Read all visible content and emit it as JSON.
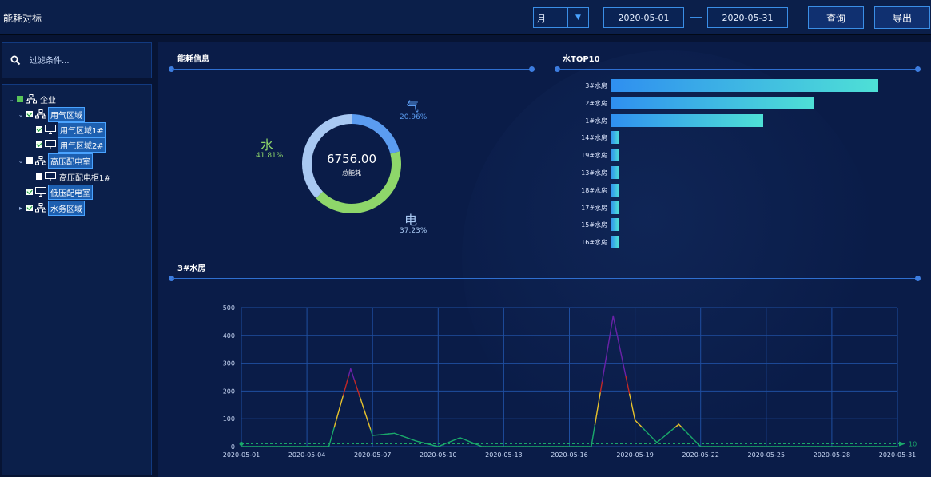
{
  "header": {
    "title": "能耗对标",
    "period": {
      "value": "月"
    },
    "date_start": "2020-05-01",
    "date_end": "2020-05-31",
    "query_label": "查询",
    "export_label": "导出"
  },
  "filter": {
    "placeholder": "过滤条件..."
  },
  "tree": {
    "root": "企业",
    "nodes": [
      "用气区域",
      "用气区域1#",
      "用气区域2#",
      "高压配电室",
      "高压配电柜1#",
      "低压配电室",
      "水务区域"
    ]
  },
  "energy_info": {
    "title": "能耗信息",
    "total_value": "6756.00",
    "total_label": "总能耗",
    "legend": [
      {
        "name": "气",
        "pct": "20.96%",
        "color": "#5b9cf0"
      },
      {
        "name": "水",
        "pct": "41.81%",
        "color": "#8ed66a"
      },
      {
        "name": "电",
        "pct": "37.23%",
        "color": "#a8c8f2"
      }
    ]
  },
  "top10": {
    "title": "水TOP10"
  },
  "trend": {
    "title": "3#水房",
    "end_label": "10"
  },
  "colors": {
    "accent": "#3a8ee6",
    "panel": "#0b1f4a",
    "bg": "#071434"
  },
  "chart_data": [
    {
      "type": "pie",
      "title": "能耗信息",
      "categories": [
        "气",
        "水",
        "电"
      ],
      "values": [
        20.96,
        41.81,
        37.23
      ],
      "total": 6756.0
    },
    {
      "type": "bar",
      "title": "水TOP10",
      "categories": [
        "3#水房",
        "2#水房",
        "1#水房",
        "14#水房",
        "19#水房",
        "13#水房",
        "18#水房",
        "17#水房",
        "15#水房",
        "16#水房"
      ],
      "values": [
        2050,
        1560,
        1170,
        70,
        65,
        65,
        65,
        63,
        62,
        60
      ]
    },
    {
      "type": "line",
      "title": "3#水房",
      "x": [
        "2020-05-01",
        "2020-05-02",
        "2020-05-03",
        "2020-05-04",
        "2020-05-05",
        "2020-05-06",
        "2020-05-07",
        "2020-05-08",
        "2020-05-09",
        "2020-05-10",
        "2020-05-11",
        "2020-05-12",
        "2020-05-13",
        "2020-05-14",
        "2020-05-15",
        "2020-05-16",
        "2020-05-17",
        "2020-05-18",
        "2020-05-19",
        "2020-05-20",
        "2020-05-21",
        "2020-05-22",
        "2020-05-23",
        "2020-05-24",
        "2020-05-25",
        "2020-05-26",
        "2020-05-27",
        "2020-05-28",
        "2020-05-29",
        "2020-05-30",
        "2020-05-31"
      ],
      "values": [
        0,
        0,
        0,
        0,
        0,
        280,
        40,
        48,
        20,
        0,
        32,
        0,
        0,
        0,
        0,
        0,
        0,
        470,
        95,
        15,
        80,
        0,
        0,
        0,
        0,
        0,
        0,
        0,
        0,
        0,
        0
      ],
      "x_ticks": [
        "2020-05-01",
        "2020-05-04",
        "2020-05-07",
        "2020-05-10",
        "2020-05-13",
        "2020-05-16",
        "2020-05-19",
        "2020-05-22",
        "2020-05-25",
        "2020-05-28",
        "2020-05-31"
      ],
      "y_ticks": [
        0,
        100,
        200,
        300,
        400,
        500
      ],
      "ylim": [
        0,
        500
      ],
      "grid": true,
      "reference_line": 10
    }
  ]
}
